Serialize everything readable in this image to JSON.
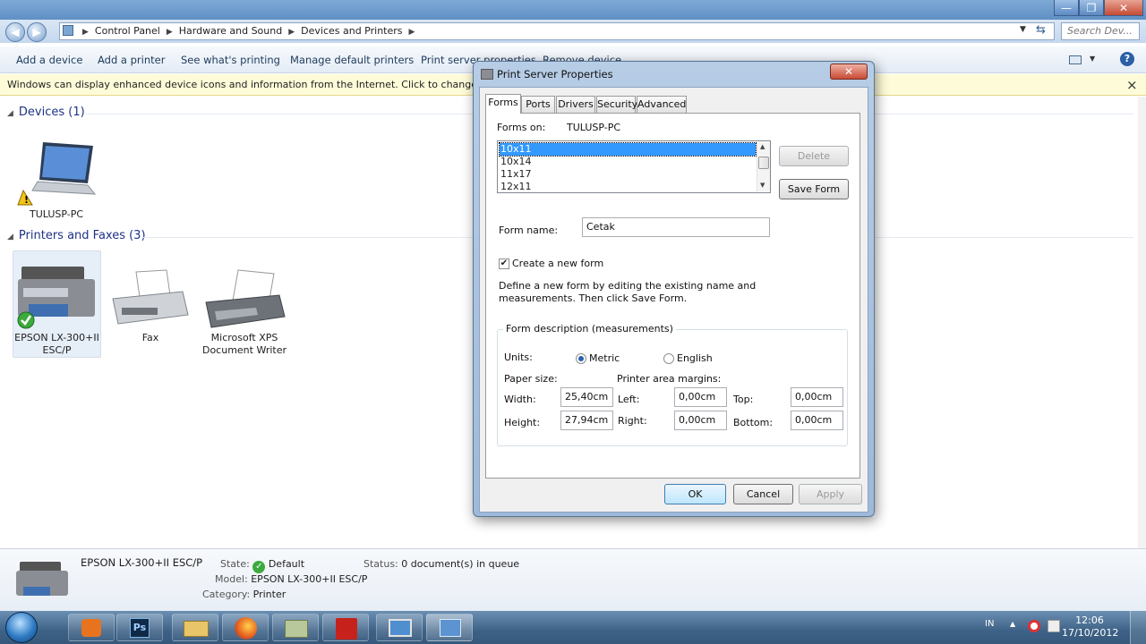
{
  "window": {
    "minimize_glyph": "—",
    "maximize_glyph": "❐",
    "close_glyph": "✕"
  },
  "address": {
    "crumbs": [
      "Control Panel",
      "Hardware and Sound",
      "Devices and Printers"
    ],
    "search_placeholder": "Search Dev..."
  },
  "commandbar": {
    "items": [
      "Add a device",
      "Add a printer",
      "See what's printing",
      "Manage default printers",
      "Print server properties",
      "Remove device"
    ]
  },
  "infobar": {
    "text": "Windows can display enhanced device icons and information from the Internet. Click to change...",
    "close": "×"
  },
  "devices_group": {
    "title": "Devices (1)",
    "items": [
      {
        "label": "TULUSP-PC"
      }
    ]
  },
  "printers_group": {
    "title": "Printers and Faxes (3)",
    "items": [
      {
        "label_line1": "EPSON LX-300+II",
        "label_line2": "ESC/P"
      },
      {
        "label_line1": "Fax",
        "label_line2": ""
      },
      {
        "label_line1": "Microsoft XPS",
        "label_line2": "Document Writer"
      }
    ]
  },
  "details": {
    "name": "EPSON LX-300+II ESC/P",
    "state_key": "State:",
    "state_val": "Default",
    "status_key": "Status:",
    "status_val": "0 document(s) in queue",
    "model_key": "Model:",
    "model_val": "EPSON LX-300+II ESC/P",
    "category_key": "Category:",
    "category_val": "Printer"
  },
  "taskbar": {
    "lang": "IN",
    "time": "12:06",
    "date": "17/10/2012"
  },
  "dialog": {
    "title": "Print Server Properties",
    "tabs": [
      "Forms",
      "Ports",
      "Drivers",
      "Security",
      "Advanced"
    ],
    "forms_on_label": "Forms on:",
    "forms_on_value": "TULUSP-PC",
    "form_list": [
      "10x11",
      "10x14",
      "11x17",
      "12x11"
    ],
    "delete_label": "Delete",
    "save_form_label": "Save Form",
    "form_name_label": "Form name:",
    "form_name_value": "Cetak",
    "create_new_label": "Create a new form",
    "create_new_checked": true,
    "desc_line1": "Define a new form by editing the existing name and",
    "desc_line2": "measurements. Then click Save Form.",
    "group_title": "Form description (measurements)",
    "units_label": "Units:",
    "metric_label": "Metric",
    "english_label": "English",
    "paper_size_label": "Paper size:",
    "margins_label": "Printer area margins:",
    "width_label": "Width:",
    "width_value": "25,40cm",
    "height_label": "Height:",
    "height_value": "27,94cm",
    "left_label": "Left:",
    "left_value": "0,00cm",
    "right_label": "Right:",
    "right_value": "0,00cm",
    "top_label": "Top:",
    "top_value": "0,00cm",
    "bottom_label": "Bottom:",
    "bottom_value": "0,00cm",
    "ok_label": "OK",
    "cancel_label": "Cancel",
    "apply_label": "Apply"
  }
}
